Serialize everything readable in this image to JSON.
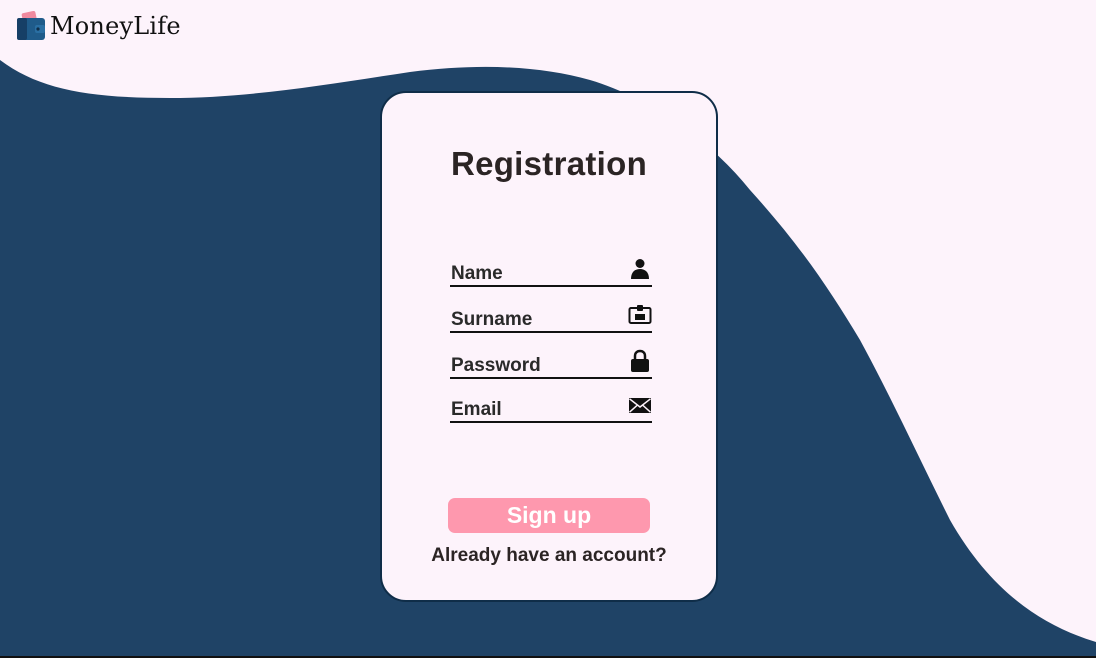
{
  "brand": {
    "name": "MoneyLife",
    "icon": "wallet-icon"
  },
  "colors": {
    "background": "#fdf3fb",
    "wave": "#1f4366",
    "card_border": "#0f2d48",
    "button": "#fe98ae",
    "text": "#2b2424"
  },
  "form": {
    "title": "Registration",
    "fields": [
      {
        "label": "Name",
        "icon": "person-icon",
        "value": ""
      },
      {
        "label": "Surname",
        "icon": "id-card-icon",
        "value": ""
      },
      {
        "label": "Password",
        "icon": "lock-icon",
        "value": ""
      },
      {
        "label": "Email",
        "icon": "envelope-icon",
        "value": ""
      }
    ],
    "submit_label": "Sign up",
    "login_link": "Already have an account?"
  }
}
